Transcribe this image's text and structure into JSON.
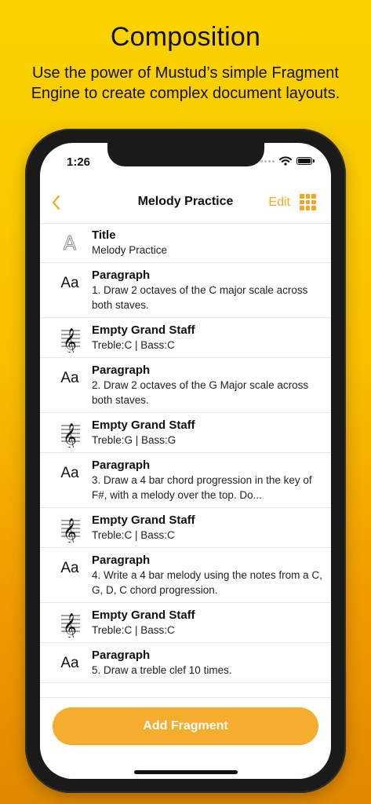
{
  "promo": {
    "title": "Composition",
    "subtitle": "Use the power of Mustud’s simple Fragment Engine to create complex document layouts."
  },
  "status_bar": {
    "time": "1:26",
    "icons": [
      "signal-dots-icon",
      "wifi-icon",
      "battery-icon"
    ]
  },
  "nav": {
    "back_icon": "chevron-left-icon",
    "title": "Melody Practice",
    "edit_label": "Edit",
    "grid_icon": "grid-icon"
  },
  "colors": {
    "accent": "#F5A623",
    "background_top": "#FBD400",
    "background_bottom": "#E08800",
    "button": "#F6AC2E"
  },
  "fragments": [
    {
      "icon": "title-a-icon",
      "type": "Title",
      "detail": "Melody Practice"
    },
    {
      "icon": "aa-text-icon",
      "type": "Paragraph",
      "detail": "1. Draw 2 octaves of the C major scale across both staves."
    },
    {
      "icon": "grand-staff-icon",
      "type": "Empty Grand Staff",
      "detail": "Treble:C | Bass:C"
    },
    {
      "icon": "aa-text-icon",
      "type": "Paragraph",
      "detail": "2. Draw 2 octaves of the G Major scale across both staves."
    },
    {
      "icon": "grand-staff-icon",
      "type": "Empty Grand Staff",
      "detail": "Treble:G | Bass:G"
    },
    {
      "icon": "aa-text-icon",
      "type": "Paragraph",
      "detail": "3. Draw a 4 bar chord progression in the key of F#, with a melody over the top. Do..."
    },
    {
      "icon": "grand-staff-icon",
      "type": "Empty Grand Staff",
      "detail": "Treble:C | Bass:C"
    },
    {
      "icon": "aa-text-icon",
      "type": "Paragraph",
      "detail": "4. Write a 4 bar melody using the notes from a C, G, D, C chord progression."
    },
    {
      "icon": "grand-staff-icon",
      "type": "Empty Grand Staff",
      "detail": "Treble:C | Bass:C"
    },
    {
      "icon": "aa-text-icon",
      "type": "Paragraph",
      "detail": "5. Draw a treble clef 10 times."
    }
  ],
  "footer": {
    "add_label": "Add Fragment"
  }
}
